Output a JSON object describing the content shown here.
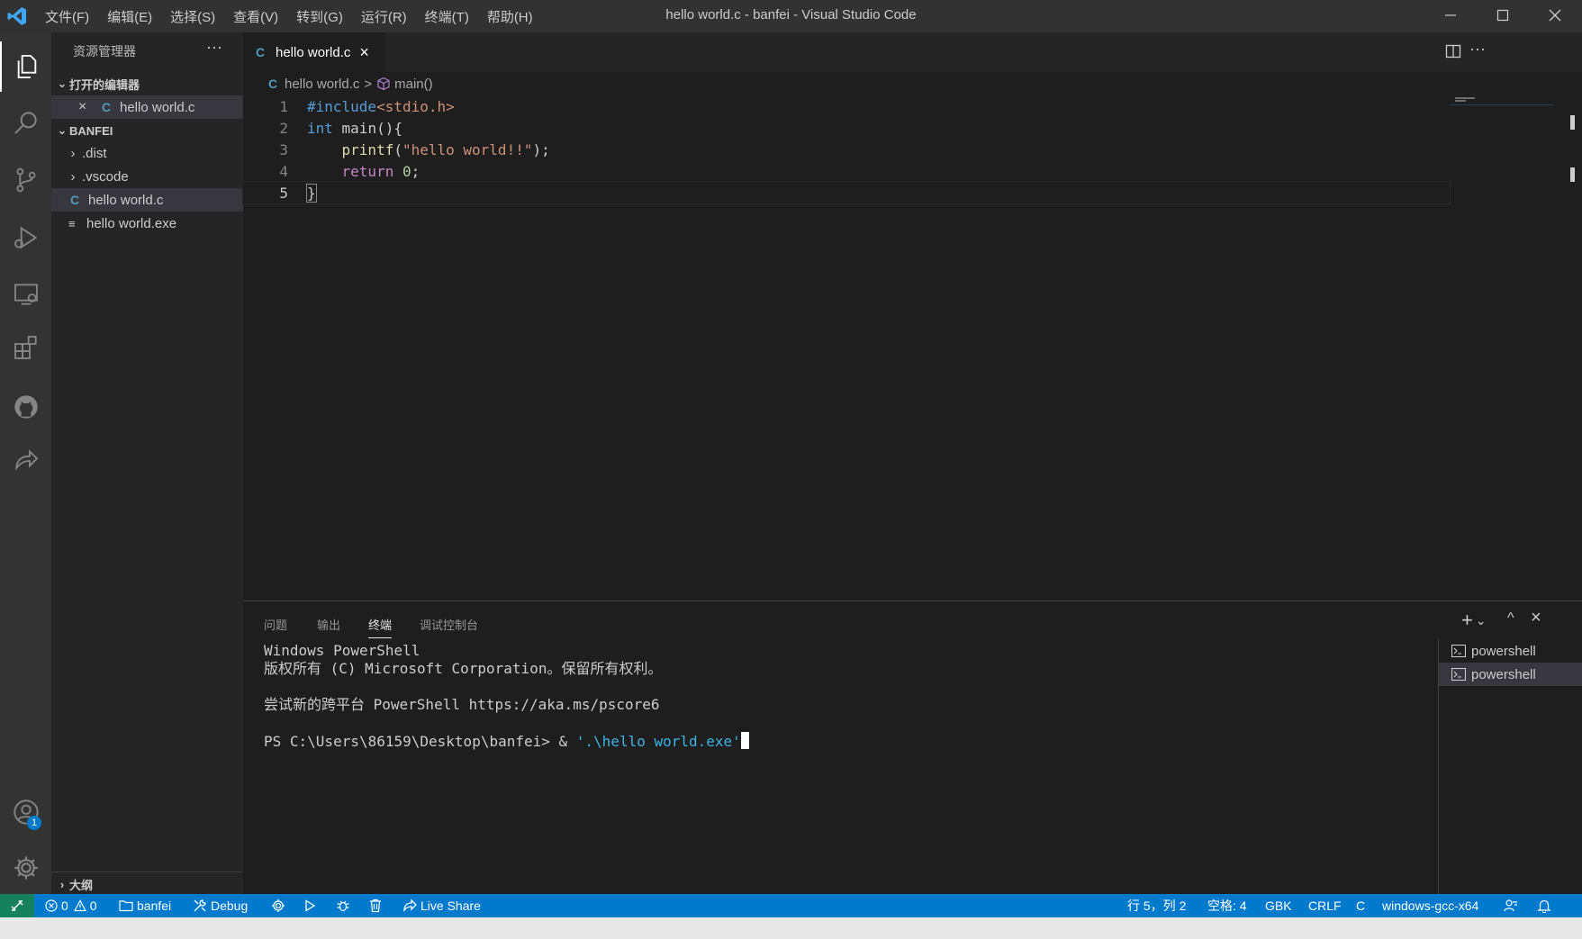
{
  "window": {
    "title": "hello world.c - banfei - Visual Studio Code",
    "menu": [
      "文件(F)",
      "编辑(E)",
      "选择(S)",
      "查看(V)",
      "转到(G)",
      "运行(R)",
      "终端(T)",
      "帮助(H)"
    ]
  },
  "activity_bar": {
    "icons": [
      "explorer-icon",
      "search-icon",
      "source-control-icon",
      "run-debug-icon",
      "remote-explorer-icon",
      "extensions-icon",
      "github-icon",
      "live-share-icon"
    ],
    "accounts_badge": "1"
  },
  "sidebar": {
    "title": "资源管理器",
    "more": "···",
    "open_editors": {
      "label": "打开的编辑器",
      "items": [
        {
          "icon": "C",
          "name": "hello world.c",
          "close": "×"
        }
      ]
    },
    "folder": {
      "label": "BANFEI",
      "items": [
        {
          "kind": "folder",
          "name": ".dist"
        },
        {
          "kind": "folder",
          "name": ".vscode"
        },
        {
          "kind": "file",
          "icon": "C",
          "name": "hello world.c"
        },
        {
          "kind": "file",
          "icon": "≡",
          "name": "hello world.exe"
        }
      ]
    },
    "outline_label": "大纲"
  },
  "editor": {
    "tab": {
      "icon": "C",
      "label": "hello world.c",
      "close": "×"
    },
    "breadcrumb": {
      "icon": "C",
      "file": "hello world.c",
      "separator": ">",
      "symbol": "main()"
    },
    "line_numbers": [
      "1",
      "2",
      "3",
      "4",
      "5"
    ],
    "code": {
      "l1_directive": "#include",
      "l1_header": "<stdio.h>",
      "l2_type": "int",
      "l2_rest": " main(){",
      "l3_indent": "    ",
      "l3_fn": "printf",
      "l3_open": "(",
      "l3_str": "\"hello world!!\"",
      "l3_close": ");",
      "l4_indent": "    ",
      "l4_kw": "return",
      "l4_space": " ",
      "l4_num": "0",
      "l4_semi": ";",
      "l5": "}"
    }
  },
  "panel": {
    "tabs": [
      "问题",
      "输出",
      "终端",
      "调试控制台"
    ],
    "active_tab": "终端",
    "terminal_lines": {
      "l1": "Windows PowerShell",
      "l2": "版权所有 (C) Microsoft Corporation。保留所有权利。",
      "l3": "",
      "l4": "尝试新的跨平台 PowerShell https://aka.ms/pscore6",
      "l5": "",
      "prompt": "PS C:\\Users\\86159\\Desktop\\banfei> ",
      "amp": "& ",
      "cmd": "'.\\hello world.exe'"
    },
    "terminals": [
      "powershell",
      "powershell"
    ],
    "controls": {
      "add": "+",
      "dropdown": "⌄",
      "maximize": "^",
      "close": "×"
    }
  },
  "status_bar": {
    "errors": "0",
    "warnings": "0",
    "folder": "banfei",
    "debug": "Debug",
    "live_share": "Live Share",
    "position": "行 5，列 2",
    "indent": "空格: 4",
    "encoding": "GBK",
    "eol": "CRLF",
    "language": "C",
    "config": "windows-gcc-x64"
  },
  "colors": {
    "accent": "#007acc",
    "remote": "#16825d",
    "activity_bg": "#333333",
    "sidebar_bg": "#252526",
    "editor_bg": "#1e1e1e"
  }
}
